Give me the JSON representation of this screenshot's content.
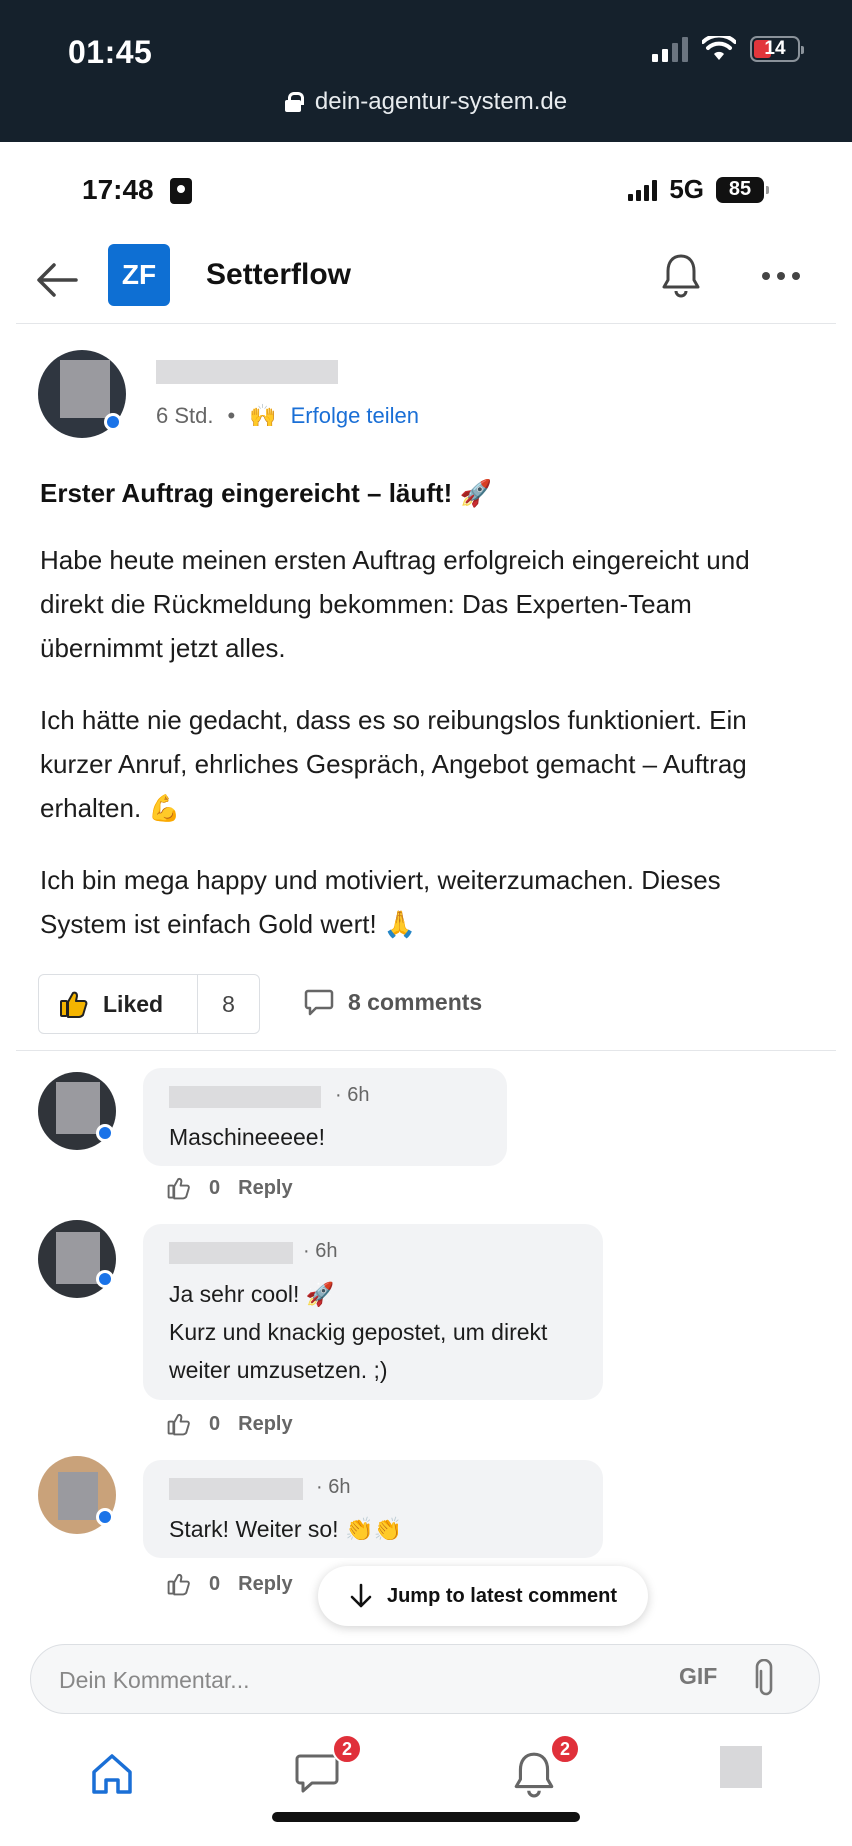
{
  "browser": {
    "time": "01:45",
    "battery": "14",
    "url": "dein-agentur-system.de"
  },
  "phone": {
    "time": "17:48",
    "network": "5G",
    "battery": "85"
  },
  "app": {
    "logo_text": "ZF",
    "title": "Setterflow"
  },
  "post": {
    "time_ago": "6 Std.",
    "separator": "•",
    "category_emoji": "🙌",
    "category": "Erfolge teilen",
    "title": "Erster Auftrag eingereicht – läuft! 🚀",
    "paragraphs": [
      "Habe heute meinen ersten Auftrag erfolgreich eingereicht und direkt die Rückmeldung bekommen: Das Experten-Team übernimmt jetzt alles.",
      "Ich hätte nie gedacht, dass es so reibungslos funktioniert. Ein kurzer Anruf, ehrliches Gespräch, Angebot gemacht – Auftrag erhalten. 💪",
      "Ich bin mega happy und motiviert, weiterzumachen. Dieses System ist einfach Gold wert! 🙏"
    ],
    "like_label": "Liked",
    "like_count": "8",
    "comments_label": "8 comments"
  },
  "comments": [
    {
      "time": "· 6h",
      "lines": [
        "Maschineeeee!"
      ],
      "likes": "0",
      "reply": "Reply"
    },
    {
      "time": "· 6h",
      "lines": [
        "Ja sehr cool! 🚀",
        "Kurz und knackig gepostet, um direkt",
        "weiter umzusetzen. ;)"
      ],
      "likes": "0",
      "reply": "Reply"
    },
    {
      "time": "· 6h",
      "lines": [
        "Stark! Weiter so! 👏👏"
      ],
      "likes": "0",
      "reply": "Reply"
    }
  ],
  "jump": {
    "label": "Jump to latest comment"
  },
  "composer": {
    "placeholder": "Dein Kommentar...",
    "gif": "GIF"
  },
  "nav": {
    "messages_badge": "2",
    "notifications_badge": "2"
  },
  "colors": {
    "accent": "#1a73e8",
    "logo_bg": "#0e6fd3",
    "badge": "#e0303a",
    "chrome": "#15212c"
  }
}
